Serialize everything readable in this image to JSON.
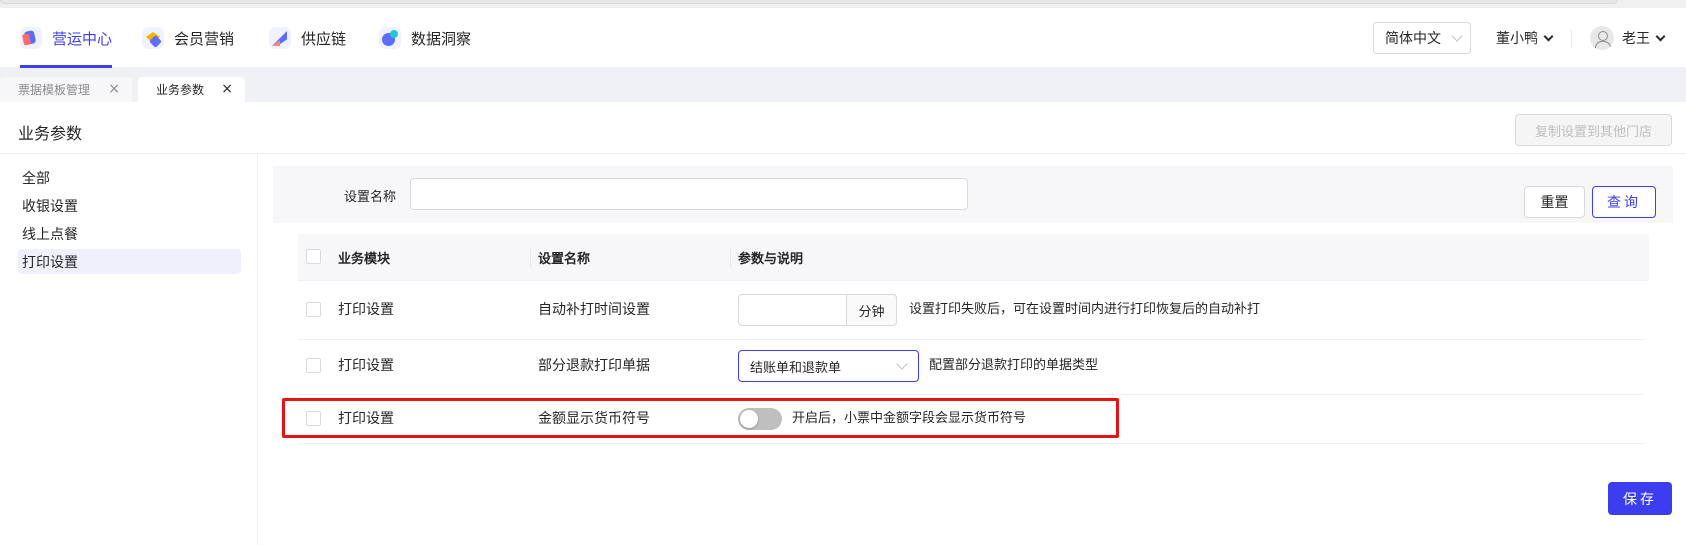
{
  "nav": {
    "items": [
      {
        "label": "营运中心",
        "icon": "operations-center-icon"
      },
      {
        "label": "会员营销",
        "icon": "member-marketing-icon"
      },
      {
        "label": "供应链",
        "icon": "supply-chain-icon"
      },
      {
        "label": "数据洞察",
        "icon": "data-insight-icon"
      }
    ],
    "active_index": 0,
    "language": "简体中文",
    "store": "董小鸭",
    "user": "老王"
  },
  "tabs": [
    {
      "label": "票据模板管理",
      "active": false
    },
    {
      "label": "业务参数",
      "active": true
    }
  ],
  "page": {
    "title": "业务参数",
    "copy_button": "复制设置到其他门店"
  },
  "side_menu": {
    "items": [
      "全部",
      "收银设置",
      "线上点餐",
      "打印设置"
    ],
    "active_index": 3
  },
  "filter": {
    "label": "设置名称",
    "value": "",
    "reset_button": "重置",
    "query_button": "查询"
  },
  "table": {
    "columns": [
      "业务模块",
      "设置名称",
      "参数与说明"
    ],
    "rows": [
      {
        "module": "打印设置",
        "name": "自动补打时间设置",
        "control": "number-input",
        "input_value": "",
        "unit": "分钟",
        "description": "设置打印失败后，可在设置时间内进行打印恢复后的自动补打"
      },
      {
        "module": "打印设置",
        "name": "部分退款打印单据",
        "control": "select",
        "selected": "结账单和退款单",
        "description": "配置部分退款打印的单据类型"
      },
      {
        "module": "打印设置",
        "name": "金额显示货币符号",
        "control": "switch",
        "switch_on": false,
        "description": "开启后，小票中金额字段会显示货币符号",
        "highlighted": true
      }
    ]
  },
  "save_button": "保存",
  "colors": {
    "primary": "#3d3df0",
    "highlight_border": "#e51414",
    "switch_off": "#bfbfbf"
  }
}
